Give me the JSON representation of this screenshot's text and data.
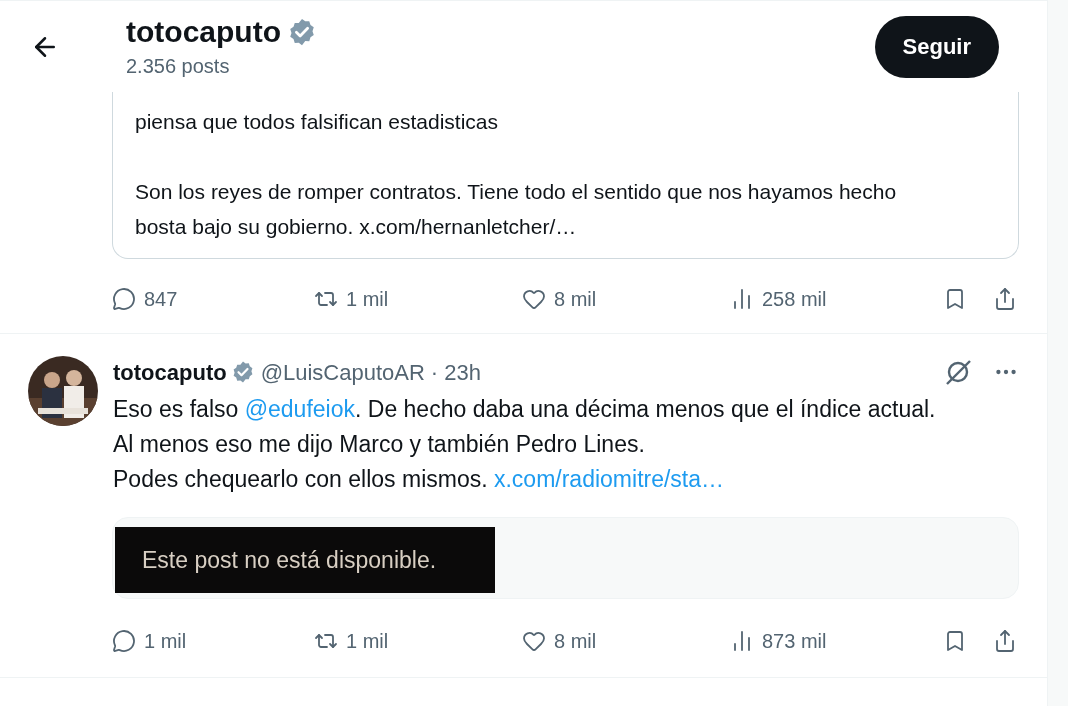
{
  "header": {
    "name": "totocaputo",
    "verified": true,
    "posts_count": "2.356 posts",
    "follow_button": "Seguir"
  },
  "posts": [
    {
      "kind": "continued",
      "quoted": {
        "paragraphs": [
          "piensa que todos falsifican estadisticas",
          "Son los reyes de romper contratos. Tiene todo el sentido que nos hayamos hecho bosta bajo su gobierno. x.com/hernanletcher/…"
        ]
      },
      "actions": {
        "replies": "847",
        "reposts": "1 mil",
        "likes": "8 mil",
        "views": "258 mil"
      }
    },
    {
      "kind": "full",
      "author": "totocaputo",
      "verified": true,
      "handle": "@LuisCaputoAR",
      "time": "· 23h",
      "paragraphs": [
        [
          {
            "kind": "text",
            "text": "Eso es falso "
          },
          {
            "kind": "link",
            "text": "@edufeiok"
          },
          {
            "kind": "text",
            "text": ". De hecho daba una décima menos que el índice actual. Al menos eso me dijo Marco y también Pedro Lines."
          }
        ],
        [
          {
            "kind": "text",
            "text": "Podes chequearlo con ellos mismos. "
          },
          {
            "kind": "link",
            "text": "x.com/radiomitre/sta…"
          }
        ]
      ],
      "unavailable_notice": "Este post no está disponible.",
      "actions": {
        "replies": "1 mil",
        "reposts": "1 mil",
        "likes": "8 mil",
        "views": "873 mil"
      }
    }
  ]
}
